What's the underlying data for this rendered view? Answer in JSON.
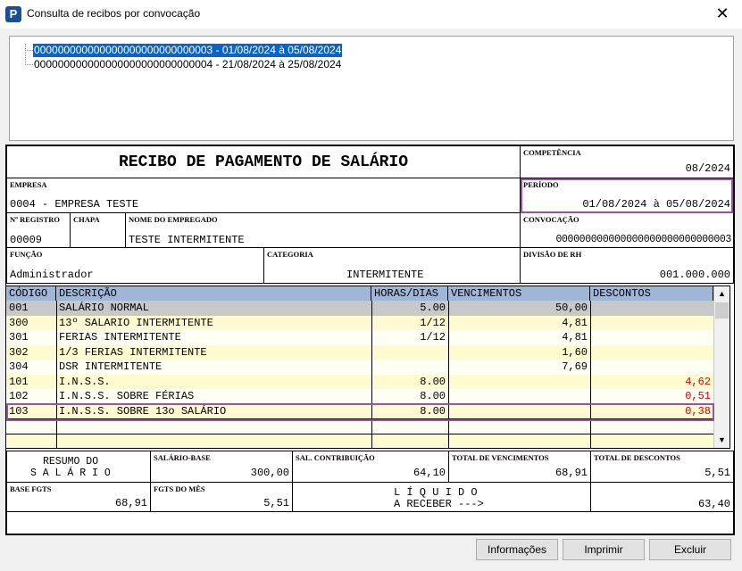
{
  "window": {
    "title": "Consulta de recibos por convocação",
    "icon_letter": "P",
    "close_glyph": "✕"
  },
  "tree": {
    "items": [
      {
        "label": "000000000000000000000000000003 - 01/08/2024 à 05/08/2024",
        "selected": true
      },
      {
        "label": "000000000000000000000000000004 - 21/08/2024 à 25/08/2024",
        "selected": false
      }
    ]
  },
  "receipt": {
    "title": "RECIBO DE PAGAMENTO DE SALÁRIO",
    "competencia_label": "COMPETÊNCIA",
    "competencia": "08/2024",
    "empresa_label": "EMPRESA",
    "empresa": "0004 - EMPRESA TESTE",
    "periodo_label": "PERÍODO",
    "periodo": "01/08/2024 à 05/08/2024",
    "registro_label": "Nº REGISTRO",
    "registro": "00009",
    "chapa_label": "CHAPA",
    "chapa": "",
    "nome_label": "NOME DO EMPREGADO",
    "nome": "TESTE INTERMITENTE",
    "convocacao_label": "CONVOCAÇÃO",
    "convocacao": "000000000000000000000000000003",
    "funcao_label": "FUNÇÃO",
    "funcao": "Administrador",
    "categoria_label": "CATEGORIA",
    "categoria": "INTERMITENTE",
    "divisao_label": "DIVISÃO DE RH",
    "divisao": "001.000.000"
  },
  "grid": {
    "headers": [
      "CÓDIGO",
      "DESCRIÇÃO",
      "HORAS/DIAS",
      "VENCIMENTOS",
      "DESCONTOS"
    ],
    "rows": [
      {
        "codigo": "001",
        "descricao": "SALÁRIO NORMAL",
        "horas": "5.00",
        "vencimentos": "50,00",
        "descontos": ""
      },
      {
        "codigo": "300",
        "descricao": "13º SALARIO INTERMITENTE",
        "horas": "1/12",
        "vencimentos": "4,81",
        "descontos": ""
      },
      {
        "codigo": "301",
        "descricao": "FERIAS INTERMITENTE",
        "horas": "1/12",
        "vencimentos": "4,81",
        "descontos": ""
      },
      {
        "codigo": "302",
        "descricao": "1/3 FERIAS INTERMITENTE",
        "horas": "",
        "vencimentos": "1,60",
        "descontos": ""
      },
      {
        "codigo": "304",
        "descricao": "DSR INTERMITENTE",
        "horas": "",
        "vencimentos": "7,69",
        "descontos": ""
      },
      {
        "codigo": "101",
        "descricao": "I.N.S.S.",
        "horas": "8.00",
        "vencimentos": "",
        "descontos": "4,62"
      },
      {
        "codigo": "102",
        "descricao": "I.N.S.S. SOBRE FÉRIAS",
        "horas": "8.00",
        "vencimentos": "",
        "descontos": "0,51"
      },
      {
        "codigo": "103",
        "descricao": "I.N.S.S. SOBRE 13o SALÁRIO",
        "horas": "8.00",
        "vencimentos": "",
        "descontos": "0,38"
      }
    ]
  },
  "totals": {
    "resumo_line1": "RESUMO DO",
    "resumo_line2": "S A L Á R I O",
    "salario_base_label": "SALÁRIO-BASE",
    "salario_base": "300,00",
    "sal_contribuicao_label": "SAL. CONTRIBUIÇÃO",
    "sal_contribuicao": "64,10",
    "total_vencimentos_label": "TOTAL DE VENCIMENTOS",
    "total_vencimentos": "68,91",
    "total_descontos_label": "TOTAL DE DESCONTOS",
    "total_descontos": "5,51",
    "base_fgts_label": "BASE FGTS",
    "base_fgts": "68,91",
    "fgts_mes_label": "FGTS DO MÊS",
    "fgts_mes": "5,51",
    "liquido_line1": "L Í Q U I D O",
    "liquido_line2": "A RECEBER --->",
    "liquido": "63,40"
  },
  "buttons": {
    "informacoes": "Informações",
    "imprimir": "Imprimir",
    "excluir": "Excluir"
  },
  "colors": {
    "selection": "#0a64c8",
    "header": "#9fb6d8",
    "highlight": "#9b4fa6",
    "discount_text": "#e00000",
    "row_selected": "#c8c8c8"
  }
}
